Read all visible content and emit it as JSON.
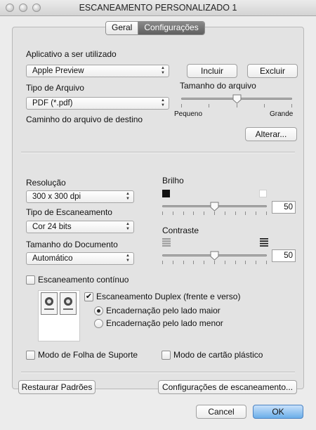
{
  "window": {
    "title": "ESCANEAMENTO PERSONALIZADO 1"
  },
  "tabs": [
    {
      "label": "Geral"
    },
    {
      "label": "Configurações",
      "selected": true
    }
  ],
  "app": {
    "label": "Aplicativo a ser utilizado",
    "selected": "Apple Preview",
    "add_label": "Incluir",
    "remove_label": "Excluir"
  },
  "file_type": {
    "label": "Tipo de Arquivo",
    "selected": "PDF (*.pdf)"
  },
  "file_size": {
    "label": "Tamanho do arquivo",
    "min_label": "Pequeno",
    "max_label": "Grande",
    "level": 0.5
  },
  "dest": {
    "label": "Caminho do arquivo de destino",
    "change_label": "Alterar..."
  },
  "resolution": {
    "label": "Resolução",
    "selected": "300 x 300 dpi"
  },
  "scan_type": {
    "label": "Tipo de Escaneamento",
    "selected": "Cor 24 bits"
  },
  "doc_size": {
    "label": "Tamanho do Documento",
    "selected": "Automático"
  },
  "brightness": {
    "label": "Brilho",
    "value": "50",
    "level": 0.5
  },
  "contrast": {
    "label": "Contraste",
    "value": "50",
    "level": 0.5
  },
  "continuous": {
    "label": "Escaneamento contínuo",
    "checked": false
  },
  "duplex": {
    "label": "Escaneamento Duplex (frente e verso)",
    "checked": true,
    "long_edge": "Encadernação pelo lado maior",
    "short_edge": "Encadernação pelo lado menor",
    "selected": "long_edge"
  },
  "carrier_sheet": {
    "label": "Modo de Folha de Suporte",
    "checked": false
  },
  "plastic_card": {
    "label": "Modo de cartão plástico",
    "checked": false
  },
  "footer": {
    "restore_label": "Restaurar Padrões",
    "scan_settings_label": "Configurações de escaneamento...",
    "cancel_label": "Cancel",
    "ok_label": "OK"
  },
  "colors": {
    "default_button": "#6aaee9",
    "selected_tab": "#6f6f6f"
  }
}
